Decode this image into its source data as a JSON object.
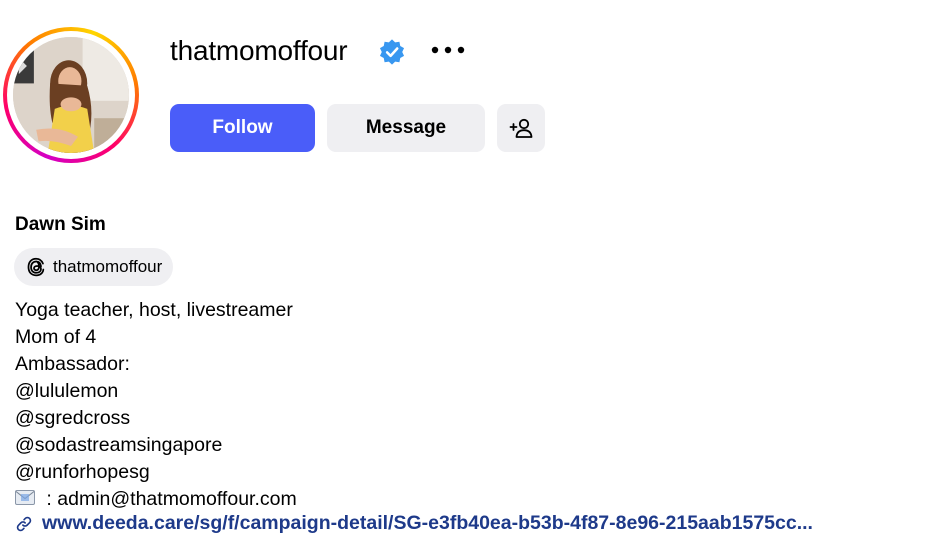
{
  "profile": {
    "username": "thatmomoffour",
    "full_name": "Dawn Sim",
    "threads_handle": "thatmomoffour",
    "verified_badge_color": "#3897f0",
    "avatar_ring_colors": [
      "#d300c5",
      "#ff0069",
      "#ff7a00",
      "#ffd600"
    ]
  },
  "actions": {
    "follow_label": "Follow",
    "message_label": "Message",
    "follow_color": "#4a5df9",
    "more_icon": "more-horizontal-icon",
    "add_user_icon": "person-add-icon"
  },
  "bio": {
    "lines": [
      "Yoga teacher, host, livestreamer",
      "Mom of 4",
      "Ambassador:",
      "@lululemon",
      "@sgredcross",
      "@sodastreamsingapore",
      "@runforhopesg"
    ],
    "email_text": ": admin@thatmomoffour.com",
    "email_icon": "envelope-icon"
  },
  "link": {
    "text": "www.deeda.care/sg/f/campaign-detail/SG-e3fb40ea-b53b-4f87-8e96-215aab1575cc...",
    "icon": "link-icon",
    "color": "#1e3a8a"
  }
}
